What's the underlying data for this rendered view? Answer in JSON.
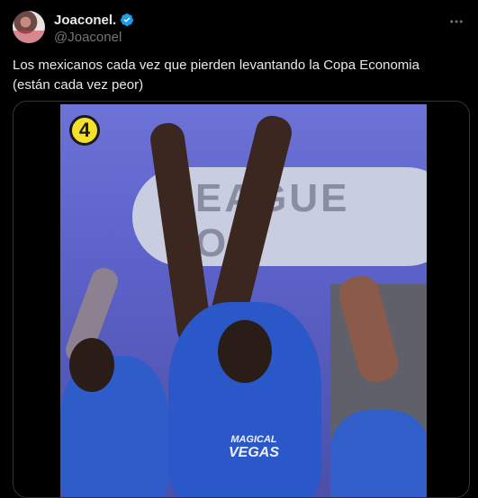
{
  "tweet": {
    "author": {
      "display_name": "Joaconel.",
      "handle": "@Joaconel",
      "verified": true
    },
    "more_icon": "more-horizontal-icon",
    "text_line1": "Los mexicanos cada vez que pierden levantando la Copa Economia",
    "text_line2": "(están cada vez peor)",
    "media": {
      "badge_number": "4",
      "board_text": "EAGUE ON",
      "sponsor_line1": "MAGICAL",
      "sponsor_line2": "VEGAS"
    }
  },
  "colors": {
    "background": "#000000",
    "text": "#e7e9ea",
    "secondary": "#71767b",
    "verified": "#1d9bf0",
    "badge": "#f5e12b"
  }
}
